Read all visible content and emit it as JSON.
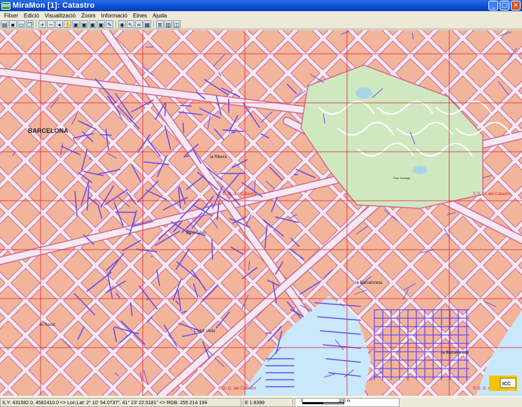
{
  "window": {
    "title": "MiraMon [1]:  Catastro",
    "app_icon": "miramon-app-icon",
    "buttons": [
      "minimize-icon",
      "maximize-icon",
      "close-icon"
    ]
  },
  "menu": [
    "Fitxer",
    "Edició",
    "Visualització",
    "Zoom",
    "Informació",
    "Eines",
    "Ajuda"
  ],
  "toolbar": {
    "tools": [
      {
        "name": "open-folder-icon",
        "glyph": "▤"
      },
      {
        "name": "save-icon",
        "glyph": "▪"
      },
      {
        "name": "print-icon",
        "glyph": "▭"
      },
      {
        "name": "copy-icon",
        "glyph": "❐"
      },
      {
        "name": "zoom-in-icon",
        "glyph": "+"
      },
      {
        "name": "zoom-out-icon",
        "glyph": "−"
      },
      {
        "name": "zoom-previous-icon",
        "glyph": "◂"
      },
      {
        "name": "pan-hand-icon",
        "glyph": "✋"
      },
      {
        "name": "view-all-icon",
        "glyph": "▣"
      },
      {
        "name": "view-layer-icon",
        "glyph": "▣"
      },
      {
        "name": "view-zoom-box-icon",
        "glyph": "▣"
      },
      {
        "name": "view-next-icon",
        "glyph": "▣"
      },
      {
        "name": "edit-brush-icon",
        "glyph": "✎"
      },
      {
        "name": "info-query-icon",
        "glyph": "◉"
      },
      {
        "name": "pointer-icon",
        "glyph": "↖"
      },
      {
        "name": "binoculars-icon",
        "glyph": "∞"
      },
      {
        "name": "measure-icon",
        "glyph": "▦"
      },
      {
        "name": "layers-icon",
        "glyph": "≣"
      },
      {
        "name": "legend-icon",
        "glyph": "▥"
      },
      {
        "name": "overview-icon",
        "glyph": "◫"
      }
    ]
  },
  "map": {
    "colors": {
      "land": "#f2b59c",
      "block_edge": "#cf6a8e",
      "street": "#f7e8f4",
      "parcel_line": "#6a4ee8",
      "grid": "#e0202a",
      "park": "#cfe8c0",
      "park_paths": "#ffffff",
      "water": "#c9e8fb",
      "label": "#222222",
      "copyright": "#e02020"
    },
    "labels": {
      "district_barcelona": "BARCELONA",
      "la_ribera": "la Ribera",
      "barri_gotic": "Barri Gòtic",
      "el_raval": "el Raval",
      "ciutat_vella": "Ciutat Vella",
      "la_barceloneta_1": "la Barceloneta",
      "la_barceloneta_2": "la Barceloneta",
      "parc_zoologic": "Parc Zoològic"
    },
    "copyright": "© D. G. del Catastro",
    "logo_text": "ICC"
  },
  "status": {
    "coords": "X,Y: 431582.0, 4582410.0 <> Lon,Lat: 2° 10' 54.0737\", 41° 23' 22.5181\" <> RGB: 255 214 194",
    "scale": "E 1:8399",
    "scalebar_0": "0",
    "scalebar_max": "200 m"
  }
}
